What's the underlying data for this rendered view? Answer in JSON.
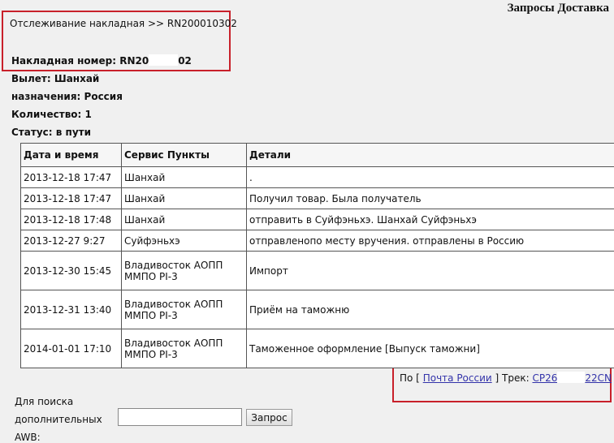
{
  "header": {
    "title": "Запросы Доставка"
  },
  "tracking": {
    "heading": "Отслеживание накладная >> RN200010302",
    "waybill_label": "Накладная номер:",
    "waybill_prefix": "RN20",
    "waybill_suffix": "02",
    "departure_label": "Вылет:",
    "departure": "Шанхай",
    "destination_label": "назначения:",
    "destination": "Россия",
    "quantity_label": "Количество:",
    "quantity": "1",
    "status_label": "Статус:",
    "status": "в пути"
  },
  "table": {
    "headers": [
      "Дата и время",
      "Сервис Пункты",
      "Детали"
    ],
    "rows": [
      [
        "2013-12-18 17:47",
        "Шанхай",
        "."
      ],
      [
        "2013-12-18 17:47",
        "Шанхай",
        "Получил товар. Была получатель"
      ],
      [
        "2013-12-18 17:48",
        "Шанхай",
        "отправить в Суйфэньхэ. Шанхай Суйфэньхэ"
      ],
      [
        "2013-12-27 9:27",
        "Суйфэньхэ",
        "отправленопо месту вручения. отправлены в Россию"
      ],
      [
        "2013-12-30 15:45",
        "Владивосток АОПП ММПО PI-3",
        "Импорт"
      ],
      [
        "2013-12-31 13:40",
        "Владивосток АОПП ММПО PI-3",
        "Приём на таможню"
      ],
      [
        "2014-01-01 17:10",
        "Владивосток АОПП ММПО PI-3",
        "Таможенное оформление [Выпуск таможни]"
      ]
    ]
  },
  "carrier": {
    "prefix": "По [",
    "name": "Почта России",
    "middle": "] Трек:",
    "track_prefix": "CP26",
    "track_suffix": "22CN"
  },
  "search": {
    "label": "Для поиска дополнительных AWB:",
    "input_value": "",
    "button_label": "Запрос"
  },
  "colors": {
    "highlight_box": "#c8202a",
    "link": "#3333aa"
  }
}
